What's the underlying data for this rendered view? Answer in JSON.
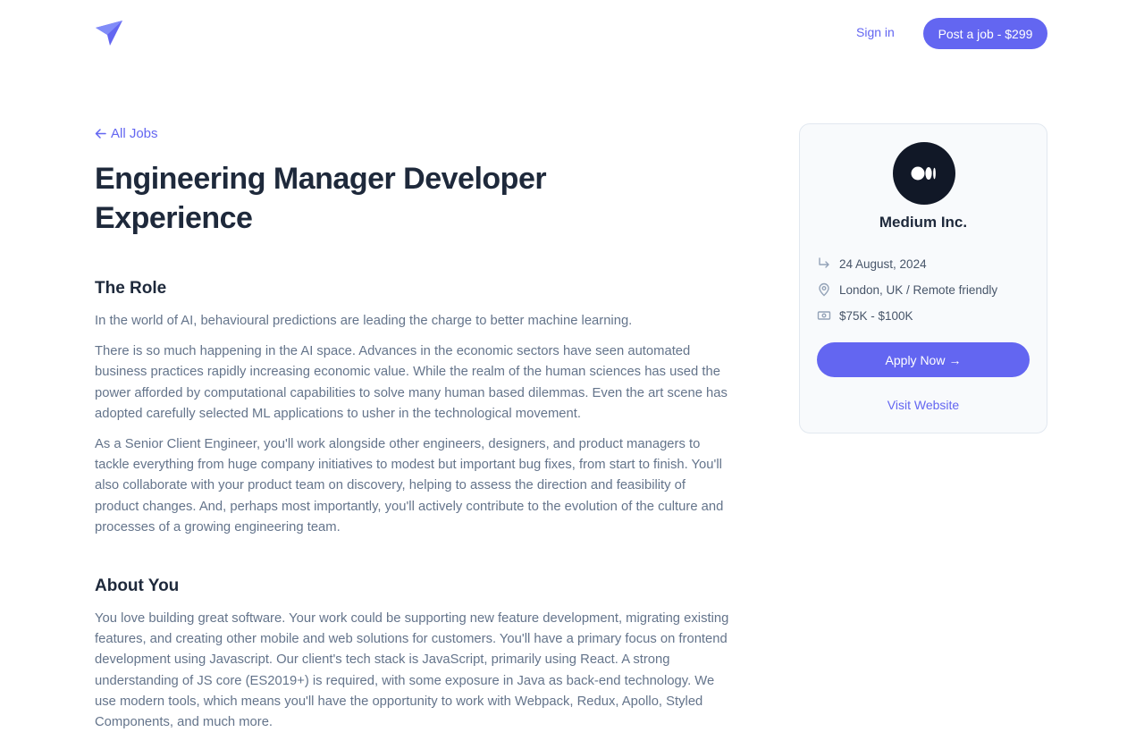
{
  "header": {
    "signin_label": "Sign in",
    "post_job_label": "Post a job - $299"
  },
  "colors": {
    "accent": "#6366f1",
    "heading": "#1e293b",
    "body_text": "#64748b"
  },
  "back_link": {
    "label": "All Jobs",
    "icon": "arrow-left-icon"
  },
  "job": {
    "title": "Engineering Manager Developer Experience",
    "sections": [
      {
        "heading": "The Role",
        "paragraphs": [
          "In the world of AI, behavioural predictions are leading the charge to better machine learning.",
          "There is so much happening in the AI space. Advances in the economic sectors have seen automated business practices rapidly increasing economic value. While the realm of the human sciences has used the power afforded by computational capabilities to solve many human based dilemmas. Even the art scene has adopted carefully selected ML applications to usher in the technological movement.",
          "As a Senior Client Engineer, you'll work alongside other engineers, designers, and product managers to tackle everything from huge company initiatives to modest but important bug fixes, from start to finish. You'll also collaborate with your product team on discovery, helping to assess the direction and feasibility of product changes. And, perhaps most importantly, you'll actively contribute to the evolution of the culture and processes of a growing engineering team."
        ]
      },
      {
        "heading": "About You",
        "paragraphs": [
          "You love building great software. Your work could be supporting new feature development, migrating existing features, and creating other mobile and web solutions for customers. You'll have a primary focus on frontend development using Javascript. Our client's tech stack is JavaScript, primarily using React. A strong understanding of JS core (ES2019+) is required, with some exposure in Java as back-end technology. We use modern tools, which means you'll have the opportunity to work with Webpack, Redux, Apollo, Styled Components, and much more."
        ]
      }
    ]
  },
  "company_card": {
    "company_name": "Medium Inc.",
    "logo_icon": "medium-logo-icon",
    "date": "24 August, 2024",
    "location": "London, UK / Remote friendly",
    "salary": "$75K - $100K",
    "apply_label": "Apply Now",
    "apply_arrow": "→",
    "visit_label": "Visit Website"
  }
}
